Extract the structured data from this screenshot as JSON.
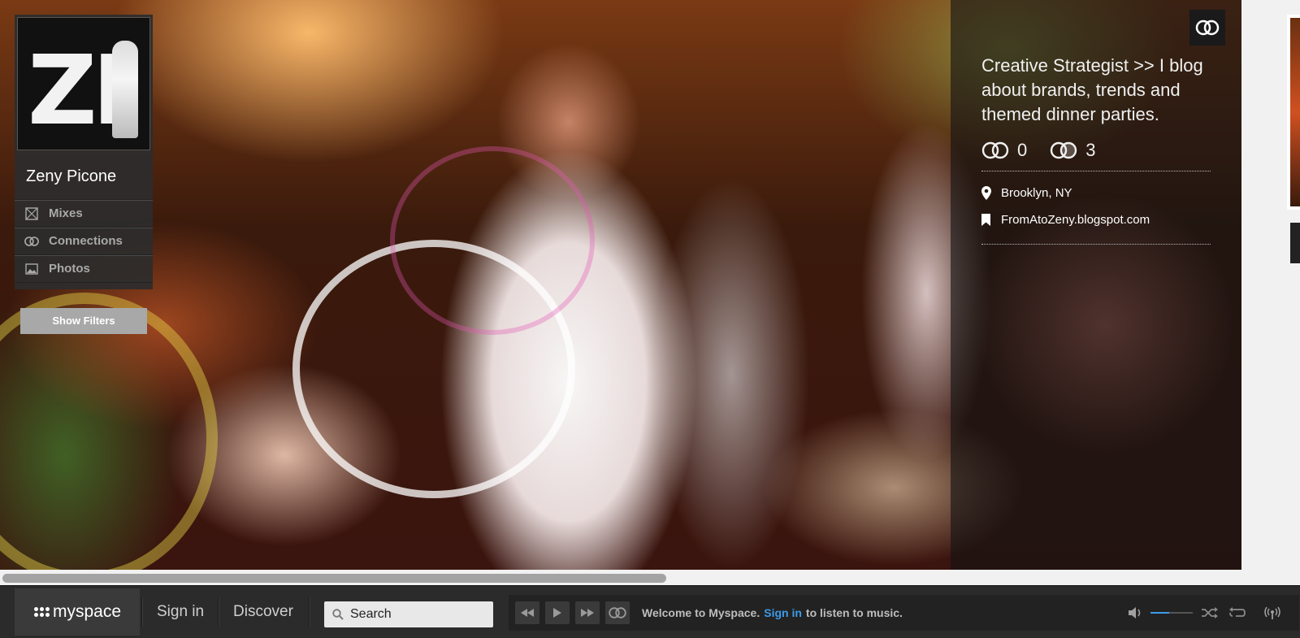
{
  "profile": {
    "avatar_text": "ZI",
    "name": "Zeny Picone",
    "menu": [
      {
        "label": "Mixes",
        "icon": "mixes-icon"
      },
      {
        "label": "Connections",
        "icon": "connections-icon"
      },
      {
        "label": "Photos",
        "icon": "photos-icon"
      }
    ],
    "show_filters_label": "Show Filters"
  },
  "info": {
    "top_icon": "connect-icon",
    "bio": "Creative Strategist >> I blog about brands, trends and themed dinner parties.",
    "stats": {
      "connections_in": "0",
      "connections_out": "3"
    },
    "location": "Brooklyn, NY",
    "website": "FromAtoZeny.blogspot.com"
  },
  "scrollbar": {
    "position_fraction": 0.0
  },
  "player": {
    "logo_text": "myspace",
    "signin_label": "Sign in",
    "discover_label": "Discover",
    "search_placeholder": "Search",
    "welcome_prefix": "Welcome to Myspace.",
    "welcome_link": "Sign in",
    "welcome_suffix": "to listen to music.",
    "volume_fraction": 0.45,
    "colors": {
      "accent": "#3d9be9",
      "bar_bg": "#2b2b2b"
    }
  }
}
